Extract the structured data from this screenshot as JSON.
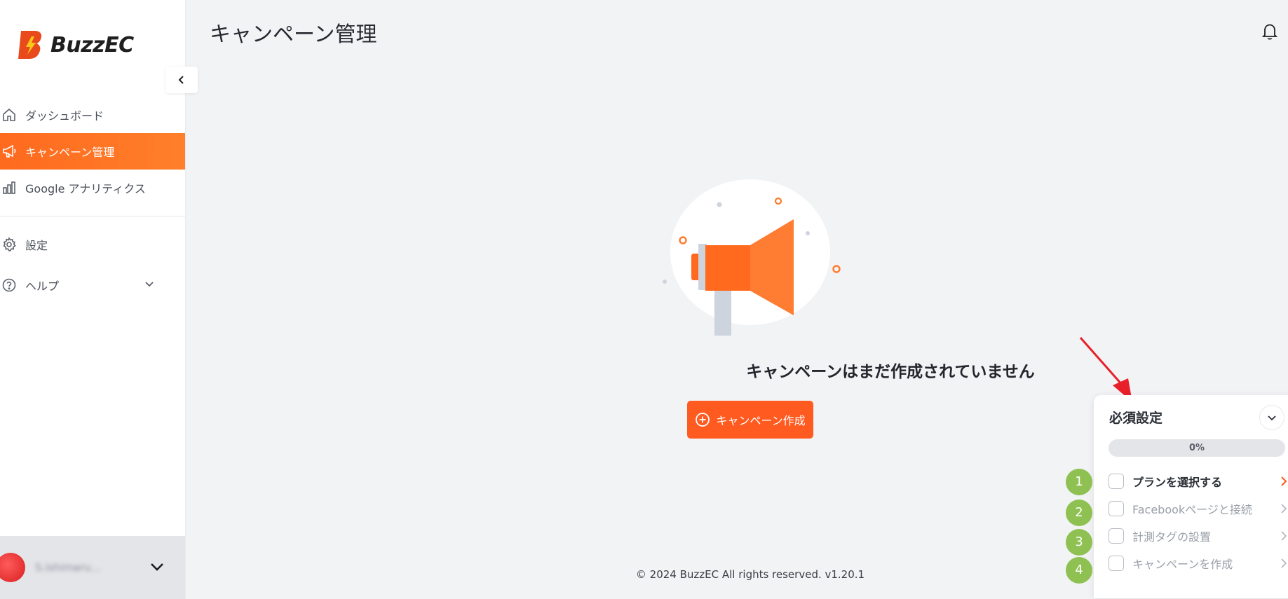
{
  "app": {
    "logo_text": "BuzzEC"
  },
  "sidebar": {
    "items": [
      {
        "label": "ダッシュボード"
      },
      {
        "label": "キャンペーン管理"
      },
      {
        "label": "Google アナリティクス"
      },
      {
        "label": "設定"
      },
      {
        "label": "ヘルプ"
      }
    ],
    "user": {
      "name": "S.ishimaru..."
    }
  },
  "header": {
    "title": "キャンペーン管理"
  },
  "main": {
    "empty_message": "キャンペーンはまだ作成されていません",
    "create_button": "キャンペーン作成",
    "footer": "© 2024 BuzzEC All rights reserved. v1.20.1"
  },
  "setup_panel": {
    "title": "必須設定",
    "progress_label": "0%",
    "progress_value": 0,
    "steps": [
      {
        "number": "1",
        "label": "プランを選択する"
      },
      {
        "number": "2",
        "label": "Facebookページと接続"
      },
      {
        "number": "3",
        "label": "計測タグの設置"
      },
      {
        "number": "4",
        "label": "キャンペーンを作成"
      }
    ]
  },
  "colors": {
    "accent": "#ff5a1f",
    "active_nav": "#ff6a1e",
    "step_badge": "#8fc152",
    "annotation_arrow": "#e8202a",
    "background": "#f2f3f5"
  }
}
